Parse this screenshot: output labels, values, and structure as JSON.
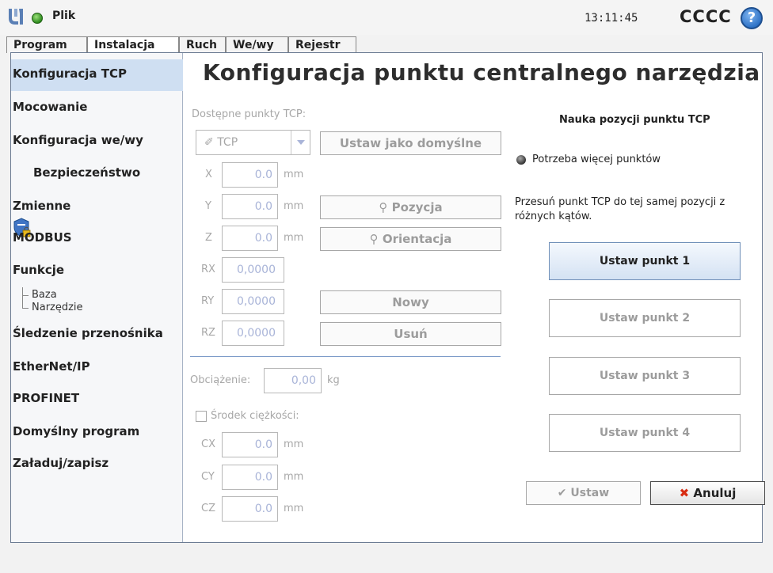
{
  "topbar": {
    "file_menu": "Plik",
    "clock": "13:11:45",
    "robot_name": "CCCC",
    "help_glyph": "?"
  },
  "tabs": [
    {
      "label": "Program"
    },
    {
      "label": "Instalacja"
    },
    {
      "label": "Ruch"
    },
    {
      "label": "We/wy"
    },
    {
      "label": "Rejestr"
    }
  ],
  "sidebar": {
    "items": [
      {
        "label": "Konfiguracja TCP"
      },
      {
        "label": "Mocowanie"
      },
      {
        "label": "Konfiguracja we/wy"
      },
      {
        "label": "Bezpieczeństwo"
      },
      {
        "label": "Zmienne"
      },
      {
        "label": "MODBUS"
      },
      {
        "label": "Funkcje"
      },
      {
        "label": "Śledzenie przenośnika"
      },
      {
        "label": "EtherNet/IP"
      },
      {
        "label": "PROFINET"
      },
      {
        "label": "Domyślny program"
      },
      {
        "label": "Załaduj/zapisz"
      }
    ],
    "sub_items": [
      "Baza",
      "Narzędzie"
    ]
  },
  "main": {
    "title": "Konfiguracja punktu centralnego narzędzia",
    "available_tcp_label": "Dostępne punkty TCP:",
    "tcp_selected": "TCP",
    "set_default_button": "Ustaw jako domyślne",
    "coords": [
      {
        "label": "X",
        "value": "0.0",
        "unit": "mm"
      },
      {
        "label": "Y",
        "value": "0.0",
        "unit": "mm"
      },
      {
        "label": "Z",
        "value": "0.0",
        "unit": "mm"
      },
      {
        "label": "RX",
        "value": "0,0000"
      },
      {
        "label": "RY",
        "value": "0,0000"
      },
      {
        "label": "RZ",
        "value": "0,0000"
      }
    ],
    "position_button": "Pozycja",
    "orientation_button": "Orientacja",
    "new_button": "Nowy",
    "delete_button": "Usuń",
    "payload_label": "Obciążenie:",
    "payload_value": "0,00",
    "payload_unit": "kg",
    "cog_label": "Środek ciężkości:",
    "cog": [
      {
        "label": "CX",
        "value": "0.0",
        "unit": "mm"
      },
      {
        "label": "CY",
        "value": "0.0",
        "unit": "mm"
      },
      {
        "label": "CZ",
        "value": "0.0",
        "unit": "mm"
      }
    ]
  },
  "teach": {
    "title": "Nauka pozycji punktu TCP",
    "status": "Potrzeba więcej punktów",
    "instruction": "Przesuń punkt TCP do tej samej pozycji z różnych kątów.",
    "points": [
      "Ustaw punkt 1",
      "Ustaw punkt 2",
      "Ustaw punkt 3",
      "Ustaw punkt 4"
    ],
    "ok_button": "Ustaw",
    "cancel_button": "Anuluj"
  },
  "colors": {
    "accent": "#cfdff2",
    "field_text": "#a9b4d8",
    "cancel_x": "#d82c12"
  }
}
